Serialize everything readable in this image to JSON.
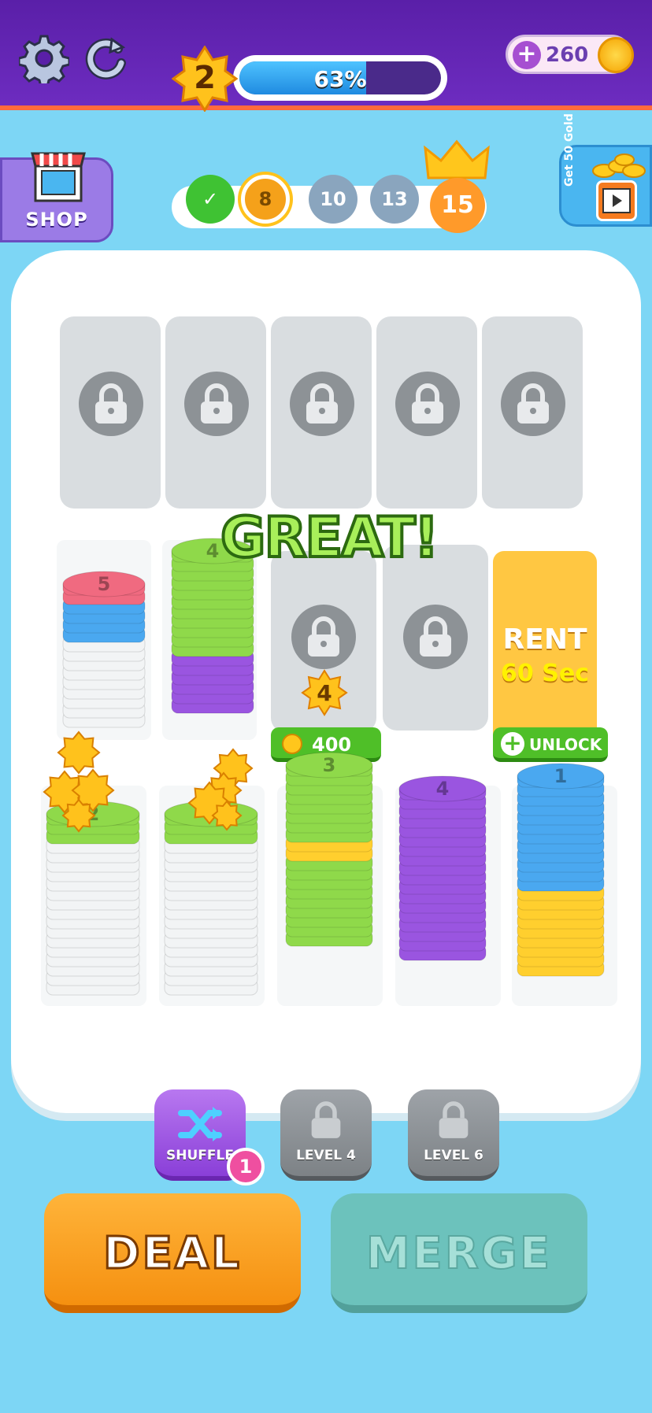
{
  "header": {
    "level": "2",
    "progress_label": "63%",
    "progress_value": 0.63,
    "coins": "260"
  },
  "shop": {
    "label": "SHOP"
  },
  "gold_ad": {
    "label": "Get 50 Gold"
  },
  "stages": [
    {
      "label": "✓",
      "state": "done",
      "color": "#3fc233"
    },
    {
      "label": "8",
      "state": "current",
      "color": "#f5a11a"
    },
    {
      "label": "10",
      "state": "upcoming",
      "color": "#8aa5be"
    },
    {
      "label": "13",
      "state": "upcoming",
      "color": "#8aa5be"
    },
    {
      "label": "15",
      "state": "goal",
      "color": "#ff9a2a"
    }
  ],
  "board": {
    "great_text": "GREAT!",
    "slot_costs": {
      "star_level": "4",
      "coin_cost": "400"
    },
    "rent": {
      "title": "RENT",
      "duration": "60 Sec",
      "unlock_label": "UNLOCK"
    },
    "stack_labels": [
      "5",
      "4",
      "2",
      "3",
      "4",
      "1"
    ]
  },
  "powerups": [
    {
      "label": "SHUFFLE",
      "badge": "1",
      "locked": false
    },
    {
      "label": "LEVEL 4",
      "locked": true
    },
    {
      "label": "LEVEL 6",
      "locked": true
    }
  ],
  "actions": {
    "deal_label": "DEAL",
    "merge_label": "MERGE"
  },
  "colors": {
    "green": "#8fd94a",
    "purple": "#9a55e0",
    "blue": "#4aa8f0",
    "yellow": "#ffcf2e",
    "red": "#f06a80",
    "white": "#f2f4f5"
  }
}
